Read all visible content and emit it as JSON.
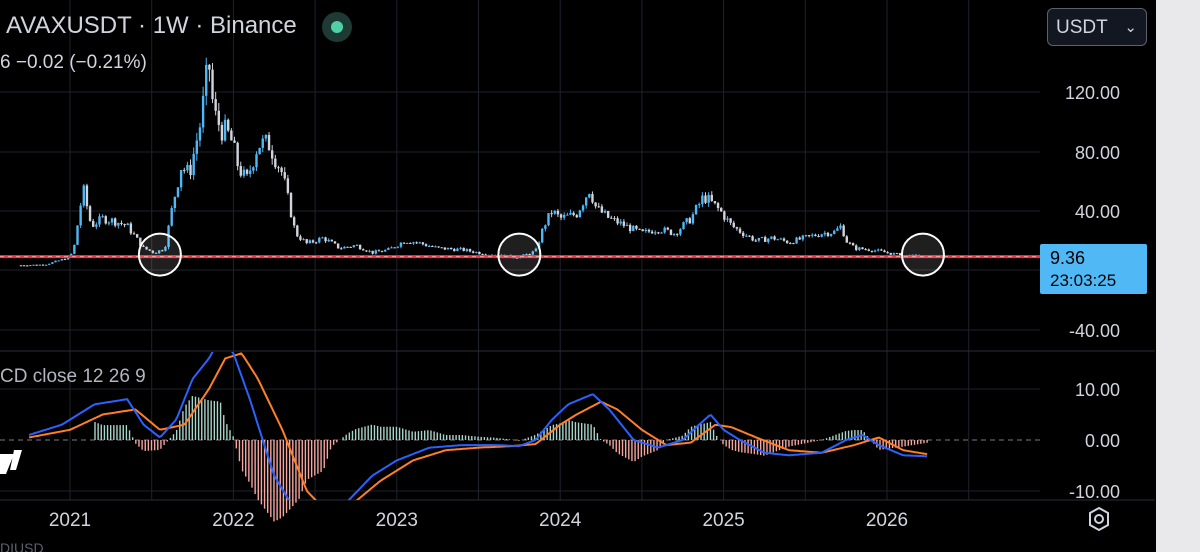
{
  "header": {
    "symbol_text": "AVAXUSDT · 1W · Binance",
    "change_text": "6  −0.02 (−0.21%)",
    "currency": "USDT",
    "currency_chevron": "⌄"
  },
  "price_label": {
    "price": "9.36",
    "countdown": "23:03:25"
  },
  "indicator": {
    "label": "CD close 12 26 9"
  },
  "bottom_fragment": "DIUSD",
  "colors": {
    "background": "#000000",
    "grid": "#1e222d",
    "candle_up": "#4fb8f5",
    "candle_down": "#d1d4dc",
    "support_line": "#f23645",
    "macd_line": "#2962ff",
    "signal_line": "#ff7f27",
    "hist_pos": "#a8d5c8",
    "hist_neg": "#f7a6a0",
    "price_tag": "#4fb8f5"
  },
  "icons": {
    "status": "status-dot-icon",
    "settings": "settings-gear-icon",
    "logo": "tradingview-logo-icon"
  },
  "chart_data": [
    {
      "type": "candlestick",
      "title": "AVAXUSDT · 1W · Binance",
      "y_ticks": [
        "120.00",
        "80.00",
        "40.00",
        "-40.00"
      ],
      "ylim": [
        -40,
        150
      ],
      "x_ticks": [
        "2021",
        "2022",
        "2023",
        "2024",
        "2025",
        "2026"
      ],
      "xlim": [
        2020.55,
        2026.75
      ],
      "support_level": 9.36,
      "highlight_circles_at": [
        2021.55,
        2023.75,
        2026.22
      ],
      "close_series": {
        "x": [
          2020.7,
          2020.85,
          2020.97,
          2021.02,
          2021.08,
          2021.13,
          2021.2,
          2021.28,
          2021.35,
          2021.45,
          2021.52,
          2021.58,
          2021.63,
          2021.68,
          2021.73,
          2021.8,
          2021.85,
          2021.88,
          2021.93,
          2021.98,
          2022.03,
          2022.08,
          2022.15,
          2022.22,
          2022.3,
          2022.38,
          2022.45,
          2022.55,
          2022.65,
          2022.75,
          2022.85,
          2022.95,
          2023.05,
          2023.12,
          2023.25,
          2023.4,
          2023.5,
          2023.62,
          2023.75,
          2023.85,
          2023.9,
          2023.95,
          2024.0,
          2024.1,
          2024.18,
          2024.22,
          2024.3,
          2024.4,
          2024.5,
          2024.6,
          2024.7,
          2024.8,
          2024.88,
          2024.93,
          2024.98,
          2025.05,
          2025.12,
          2025.2,
          2025.3,
          2025.4,
          2025.5,
          2025.6,
          2025.68,
          2025.72,
          2025.75,
          2025.8,
          2025.9,
          2026.0,
          2026.1,
          2026.2,
          2026.25
        ],
        "y": [
          3.5,
          4,
          8,
          12,
          55,
          30,
          35,
          33,
          30,
          15,
          12,
          15,
          45,
          70,
          65,
          100,
          140,
          105,
          95,
          90,
          70,
          60,
          85,
          85,
          65,
          25,
          18,
          22,
          15,
          17,
          12,
          14,
          20,
          19,
          15,
          14,
          12,
          10,
          9,
          13,
          30,
          40,
          35,
          38,
          55,
          42,
          35,
          30,
          25,
          28,
          25,
          35,
          50,
          45,
          40,
          30,
          25,
          20,
          22,
          19,
          22,
          25,
          26,
          30,
          20,
          15,
          14,
          12,
          10,
          9.5,
          9.36
        ]
      }
    },
    {
      "type": "line",
      "title": "MACD close 12 26 9",
      "y_ticks": [
        "10.00",
        "0.00",
        "-10.00"
      ],
      "ylim": [
        -10,
        18
      ],
      "series": [
        {
          "name": "MACD",
          "x": [
            2020.75,
            2020.95,
            2021.15,
            2021.35,
            2021.45,
            2021.55,
            2021.65,
            2021.75,
            2021.85,
            2021.92,
            2022.0,
            2022.1,
            2022.25,
            2022.4,
            2022.55,
            2022.7,
            2022.85,
            2023.0,
            2023.2,
            2023.4,
            2023.6,
            2023.75,
            2023.85,
            2023.95,
            2024.05,
            2024.2,
            2024.3,
            2024.45,
            2024.6,
            2024.75,
            2024.85,
            2024.92,
            2025.0,
            2025.1,
            2025.25,
            2025.4,
            2025.6,
            2025.75,
            2025.85,
            2025.95,
            2026.1,
            2026.25
          ],
          "y": [
            1,
            3,
            7,
            8,
            3,
            0.5,
            4,
            12,
            16,
            20,
            17,
            8,
            -7,
            -15,
            -18,
            -12,
            -7,
            -4,
            -1.5,
            -1,
            -1,
            -1.2,
            0,
            4,
            7,
            9,
            6,
            0,
            -1.5,
            0,
            3,
            5,
            2,
            0,
            -2.5,
            -3,
            -2.5,
            0,
            1,
            -1,
            -3,
            -3.2
          ]
        },
        {
          "name": "Signal",
          "x": [
            2020.75,
            2021.0,
            2021.2,
            2021.4,
            2021.55,
            2021.7,
            2021.85,
            2021.95,
            2022.05,
            2022.15,
            2022.3,
            2022.45,
            2022.6,
            2022.75,
            2022.9,
            2023.1,
            2023.3,
            2023.5,
            2023.7,
            2023.85,
            2024.0,
            2024.1,
            2024.25,
            2024.35,
            2024.5,
            2024.65,
            2024.8,
            2024.95,
            2025.05,
            2025.2,
            2025.4,
            2025.6,
            2025.8,
            2025.95,
            2026.1,
            2026.25
          ],
          "y": [
            0.5,
            2,
            5,
            6,
            2,
            3,
            10,
            16,
            17,
            12,
            2,
            -10,
            -15,
            -12,
            -8,
            -4,
            -2,
            -1.5,
            -1.2,
            -0.8,
            3,
            5,
            7.5,
            6,
            2,
            -1,
            -0.5,
            3,
            2.5,
            0.5,
            -2,
            -2.5,
            -1,
            0.5,
            -2,
            -2.8
          ]
        }
      ]
    }
  ]
}
